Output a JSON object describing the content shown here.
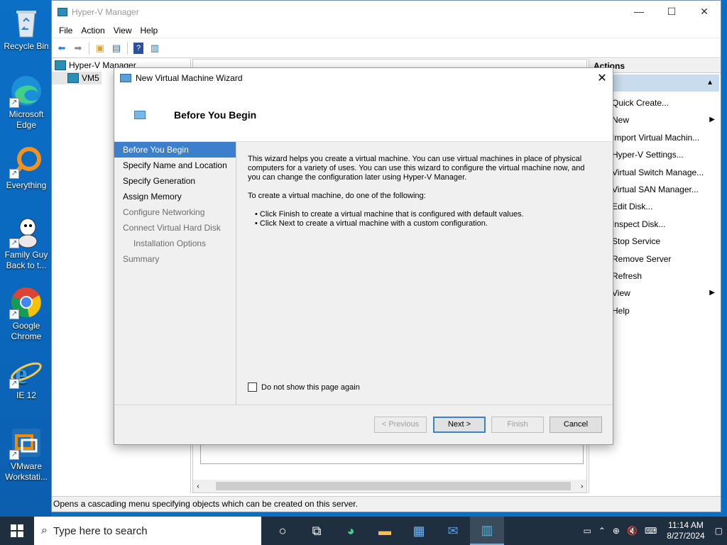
{
  "desktop": {
    "icons": [
      {
        "label": "Recycle Bin",
        "icon": "recycle-bin-icon"
      },
      {
        "label": "Microsoft Edge",
        "icon": "edge-icon"
      },
      {
        "label": "Everything",
        "icon": "everything-search-icon"
      },
      {
        "label": "Family Guy Back to t...",
        "icon": "family-guy-icon"
      },
      {
        "label": "Google Chrome",
        "icon": "chrome-icon"
      },
      {
        "label": "IE 12",
        "icon": "internet-explorer-icon"
      },
      {
        "label": "VMware Workstati...",
        "icon": "vmware-icon"
      }
    ]
  },
  "window": {
    "title": "Hyper-V Manager",
    "menu": [
      "File",
      "Action",
      "View",
      "Help"
    ],
    "tree": {
      "root": "Hyper-V Manager",
      "child": "VM5"
    },
    "actions_header": "Actions",
    "actions": [
      {
        "label": "Quick Create...",
        "submenu": false
      },
      {
        "label": "New",
        "submenu": true
      },
      {
        "label": "Import Virtual Machin...",
        "submenu": false
      },
      {
        "label": "Hyper-V Settings...",
        "submenu": false
      },
      {
        "label": "Virtual Switch Manage...",
        "submenu": false
      },
      {
        "label": "Virtual SAN Manager...",
        "submenu": false
      },
      {
        "label": "Edit Disk...",
        "submenu": false
      },
      {
        "label": "Inspect Disk...",
        "submenu": false
      },
      {
        "label": "Stop Service",
        "submenu": false
      },
      {
        "label": "Remove Server",
        "submenu": false
      },
      {
        "label": "Refresh",
        "submenu": false
      },
      {
        "label": "View",
        "submenu": true
      },
      {
        "label": "Help",
        "submenu": false
      }
    ],
    "status": "Opens a cascading menu specifying objects which can be created on this server."
  },
  "wizard": {
    "title": "New Virtual Machine Wizard",
    "heading": "Before You Begin",
    "steps": [
      {
        "label": "Before You Begin",
        "state": "active"
      },
      {
        "label": "Specify Name and Location",
        "state": "normal"
      },
      {
        "label": "Specify Generation",
        "state": "normal"
      },
      {
        "label": "Assign Memory",
        "state": "normal"
      },
      {
        "label": "Configure Networking",
        "state": "dim"
      },
      {
        "label": "Connect Virtual Hard Disk",
        "state": "dim"
      },
      {
        "label": "Installation Options",
        "state": "dim-indent"
      },
      {
        "label": "Summary",
        "state": "dim"
      }
    ],
    "para1": "This wizard helps you create a virtual machine. You can use virtual machines in place of physical computers for a variety of uses. You can use this wizard to configure the virtual machine now, and you can change the configuration later using Hyper-V Manager.",
    "para2": "To create a virtual machine, do one of the following:",
    "bullets": [
      "Click Finish to create a virtual machine that is configured with default values.",
      "Click Next to create a virtual machine with a custom configuration."
    ],
    "checkbox_label": "Do not show this page again",
    "buttons": {
      "previous": "< Previous",
      "next": "Next >",
      "finish": "Finish",
      "cancel": "Cancel"
    }
  },
  "taskbar": {
    "search_placeholder": "Type here to search",
    "time": "11:14 AM",
    "date": "8/27/2024"
  }
}
